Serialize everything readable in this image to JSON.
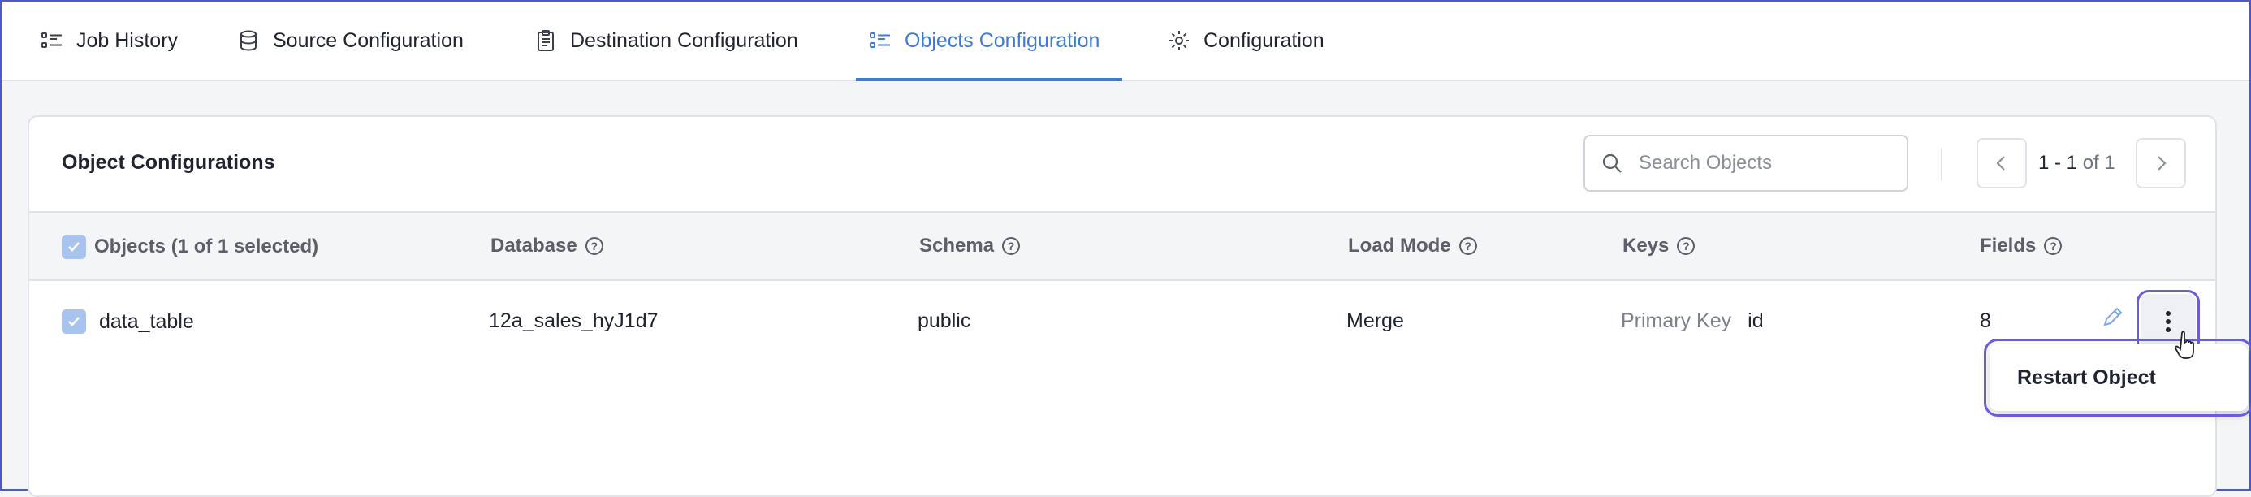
{
  "tabs": [
    {
      "label": "Job History",
      "icon": "list-icon"
    },
    {
      "label": "Source Configuration",
      "icon": "database-icon"
    },
    {
      "label": "Destination Configuration",
      "icon": "clipboard-icon"
    },
    {
      "label": "Objects Configuration",
      "icon": "list-icon",
      "active": true
    },
    {
      "label": "Configuration",
      "icon": "gear-icon"
    }
  ],
  "card": {
    "title": "Object Configurations",
    "search_placeholder": "Search Objects",
    "pagination": {
      "range": "1 - 1",
      "of": "of 1"
    }
  },
  "table": {
    "headers": {
      "objects": "Objects (1 of 1 selected)",
      "database": "Database",
      "schema": "Schema",
      "load_mode": "Load Mode",
      "keys": "Keys",
      "fields": "Fields"
    },
    "rows": [
      {
        "name": "data_table",
        "database": "12a_sales_hyJ1d7",
        "schema": "public",
        "load_mode": "Merge",
        "key_type": "Primary Key",
        "key_value": "id",
        "fields": "8"
      }
    ]
  },
  "menu": {
    "restart_label": "Restart Object"
  },
  "colors": {
    "accent": "#3f7bd4",
    "highlight": "#6a5be0",
    "checkbox": "#a8c4ee"
  }
}
